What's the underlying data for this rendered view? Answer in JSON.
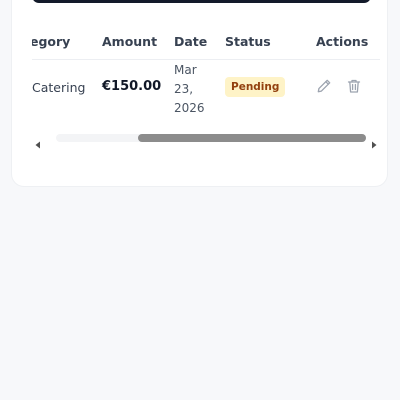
{
  "table": {
    "headers": {
      "category": "egory",
      "amount": "Amount",
      "date": "Date",
      "status": "Status",
      "actions": "Actions"
    },
    "rows": [
      {
        "category": "Catering",
        "amount": "€150.00",
        "date_lines": [
          "Mar",
          "23,",
          "2026"
        ],
        "status": "Pending"
      }
    ]
  },
  "icons": {
    "edit": "pencil-icon",
    "delete": "trash-icon",
    "scroll_left": "triangle-left-icon",
    "scroll_right": "triangle-right-icon"
  },
  "colors": {
    "page_background": "#f7f8fa",
    "card_background": "#ffffff",
    "badge_background": "#fef3c7",
    "badge_text": "#92400e",
    "scroll_thumb": "#8c8c8c"
  }
}
